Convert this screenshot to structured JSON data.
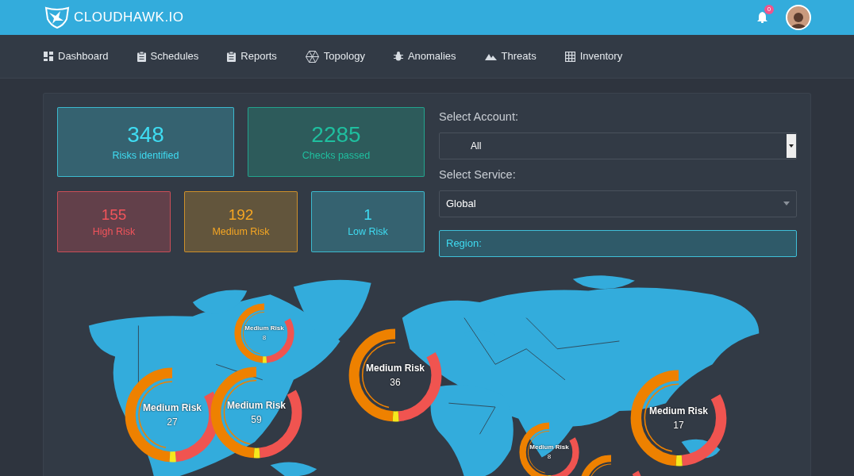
{
  "header": {
    "brand": "CLOUDHAWK.IO",
    "notifications": "0"
  },
  "nav": [
    {
      "label": "Dashboard"
    },
    {
      "label": "Schedules"
    },
    {
      "label": "Reports"
    },
    {
      "label": "Topology"
    },
    {
      "label": "Anomalies"
    },
    {
      "label": "Threats"
    },
    {
      "label": "Inventory"
    }
  ],
  "summary": [
    {
      "value": "348",
      "label": "Risks identified",
      "color": "#3fdcf2"
    },
    {
      "value": "2285",
      "label": "Checks passed",
      "color": "#1fbf9f"
    }
  ],
  "risks": [
    {
      "value": "155",
      "label": "High Risk",
      "color": "#f2545b"
    },
    {
      "value": "192",
      "label": "Medium Risk",
      "color": "#f5a623"
    },
    {
      "value": "1",
      "label": "Low Risk",
      "color": "#3fdcf2"
    }
  ],
  "filters": {
    "account": {
      "label": "Select Account:",
      "value": "All"
    },
    "service": {
      "label": "Select Service:",
      "value": "Global"
    },
    "region": {
      "label": "Region:"
    }
  },
  "map": {
    "markers": [
      {
        "kind": "labelled",
        "label": "Medium Risk",
        "count": "8"
      },
      {
        "kind": "labelled",
        "label": "Medium Risk",
        "count": "27"
      },
      {
        "kind": "labelled",
        "label": "Medium Risk",
        "count": "59"
      },
      {
        "kind": "labelled",
        "label": "Medium Risk",
        "count": "36"
      },
      {
        "kind": "labelled",
        "label": "Medium Risk",
        "count": "8"
      },
      {
        "kind": "labelled",
        "label": "Medium Risk",
        "count": "17"
      },
      {
        "kind": "bare"
      }
    ]
  }
}
